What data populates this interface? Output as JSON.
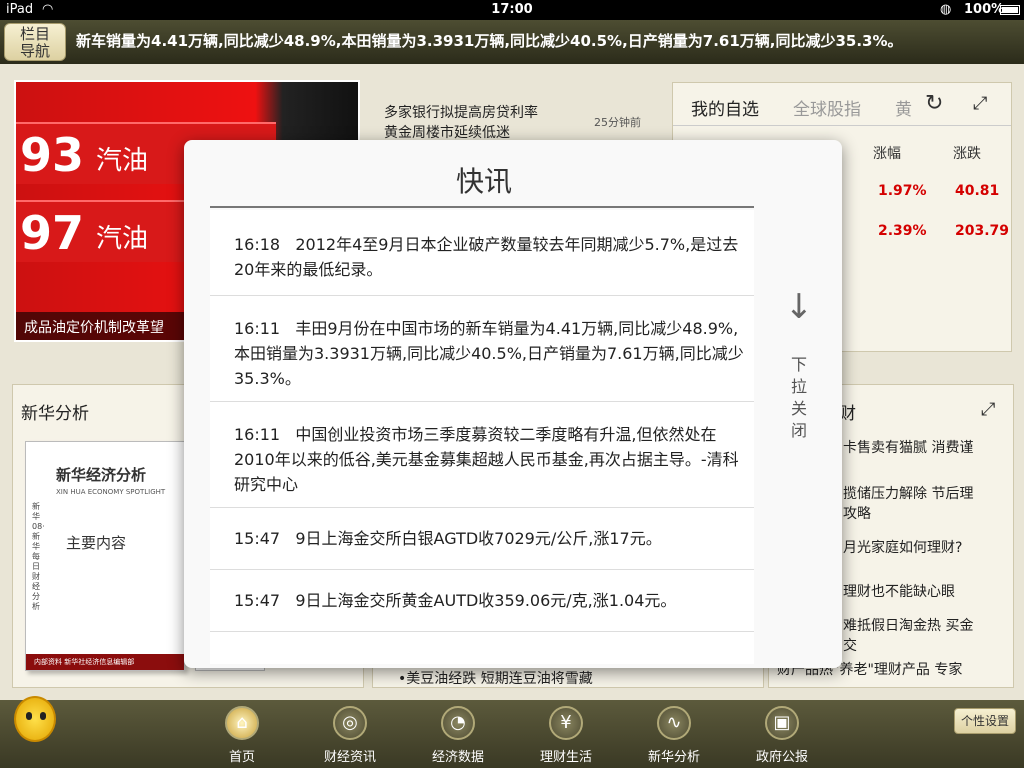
{
  "status": {
    "device": "iPad",
    "time": "17:00",
    "battery": "100%"
  },
  "ticker": {
    "nav_button": "栏目\n导航",
    "text": "新车销量为4.41万辆,同比减少48.9%,本田销量为3.3931万辆,同比减少40.5%,日产销量为7.61万辆,同比减少35.3%。"
  },
  "hero": {
    "pump1_num": "93",
    "pump1_label": "汽油",
    "pump2_num": "97",
    "pump2_label": "汽油",
    "caption": "成品油定价机制改革望"
  },
  "headlines": {
    "line1": "多家银行拟提高房贷利率",
    "line2": "黄金周楼市延续低迷",
    "time": "25分钟前"
  },
  "watchlist": {
    "tab_mine": "我的自选",
    "tab_global": "全球股指",
    "tab_gold": "黄",
    "col_change_pct": "涨幅",
    "col_change": "涨跌",
    "rows": [
      {
        "pct": "1.97%",
        "chg": "40.81"
      },
      {
        "pct": "2.39%",
        "chg": "203.79"
      }
    ]
  },
  "analysis": {
    "title": "新华分析",
    "book_name": "新华经济分析",
    "book_sub": "XIN HUA ECONOMY SPOTLIGHT",
    "book_head": "主要内容",
    "book_side": "新华08·新华每日财经分析",
    "book_foot": "内部资料  新华社经济信息编辑部"
  },
  "mid": {
    "line": "•美豆油经跌 短期连豆油将雪藏"
  },
  "finance": {
    "title": "财",
    "items": [
      "卡售卖有猫腻 消费谨",
      "揽储压力解除 节后理",
      "攻略",
      "月光家庭如何理财?",
      "理财也不能缺心眼",
      "难抵假日淘金热 买金",
      "交",
      "财产品热\"养老\"理财产品 专家"
    ]
  },
  "tabbar": {
    "items": [
      "首页",
      "财经资讯",
      "经济数据",
      "理财生活",
      "新华分析",
      "政府公报"
    ],
    "personal": "个性设置"
  },
  "modal": {
    "title": "快讯",
    "pull_hint": "下拉关闭",
    "items": [
      {
        "time": "16:18",
        "text": "2012年4至9月日本企业破产数量较去年同期减少5.7%,是过去20年来的最低纪录。"
      },
      {
        "time": "16:11",
        "text": "丰田9月份在中国市场的新车销量为4.41万辆,同比减少48.9%,本田销量为3.3931万辆,同比减少40.5%,日产销量为7.61万辆,同比减少35.3%。"
      },
      {
        "time": "16:11",
        "text": "中国创业投资市场三季度募资较二季度略有升温,但依然处在2010年以来的低谷,美元基金募集超越人民币基金,再次占据主导。-清科研究中心"
      },
      {
        "time": "15:47",
        "text": "9日上海金交所白银AGTD收7029元/公斤,涨17元。"
      },
      {
        "time": "15:47",
        "text": "9日上海金交所黄金AUTD收359.06元/克,涨1.04元。"
      }
    ]
  }
}
